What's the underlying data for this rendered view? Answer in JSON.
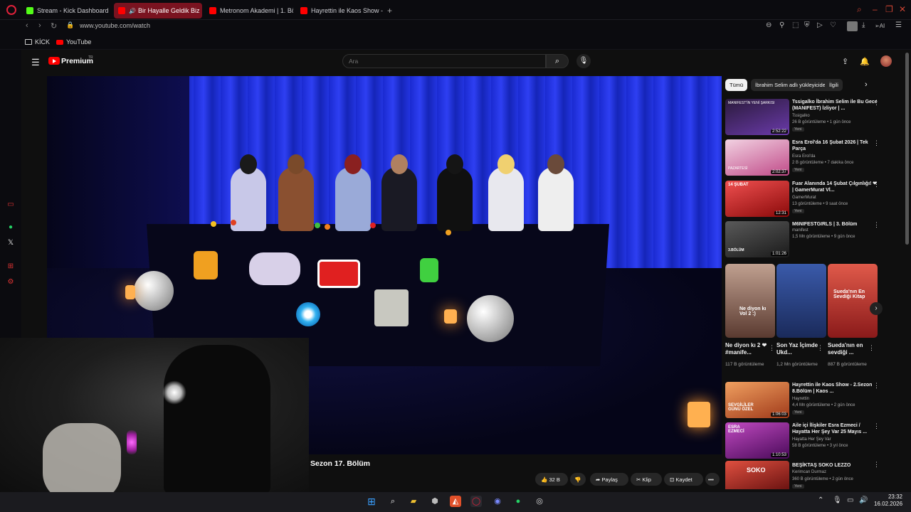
{
  "browser": {
    "tabs": [
      {
        "label": "Stream - Kick Dashboard",
        "icon": "kick-icon",
        "color": "#53fc18"
      },
      {
        "label": "Bir Hayalle Geldik Biz",
        "icon": "youtube-icon",
        "color": "#ff0000",
        "active": true
      },
      {
        "label": "Metronom Akademi | 1. Bö",
        "icon": "youtube-icon",
        "color": "#ff0000"
      },
      {
        "label": "Hayrettin ile Kaos Show - 2",
        "icon": "youtube-icon",
        "color": "#ff0000"
      }
    ],
    "url": "www.youtube.com/watch",
    "ai_label": "AI",
    "bookmarks": [
      {
        "label": "KİCK",
        "icon": "folder-icon"
      },
      {
        "label": "YouTube",
        "icon": "youtube-icon"
      }
    ]
  },
  "youtube": {
    "brand": "Premium",
    "region": "TR",
    "search_placeholder": "Ara"
  },
  "video": {
    "title": "Sezon 17. Bölüm",
    "like_count": "32 B",
    "share_label": "Paylaş",
    "clip_label": "Klip",
    "save_label": "Kaydet",
    "more_label": "•••"
  },
  "chips": [
    "Tümü",
    "İbrahim Selim adlı yükleyiciden",
    "İlgili"
  ],
  "recommendations": [
    {
      "title": "Tssigalko İbrahim Selim ile Bu Gece (MANIFEST) İzliyor | ...",
      "channel": "Tssigalko",
      "meta": "26 B görüntüleme • 1 gün önce",
      "badge": "Yeni",
      "duration": "2:52:22",
      "thumb_color": "#5a3a7a",
      "thumb_text": "MANIFEST'İN YENİ ŞARKISI"
    },
    {
      "title": "Esra Erol'da 16 Şubat 2026 | Tek Parça",
      "channel": "Esra Erol'da",
      "meta": "2 B görüntüleme • 7 dakika önce",
      "badge": "Yeni",
      "duration": "2:02:37",
      "thumb_color": "#e07aa8",
      "thumb_text": "PAZARTESİ"
    },
    {
      "title": "Fuar Alanında 14 Şubat Çılgınlığı! ❤ | GamerMurat Vl...",
      "channel": "GamerMurat",
      "meta": "13 görüntüleme • 9 saat önce",
      "badge": "Yeni",
      "duration": "12:31",
      "thumb_color": "#c01818",
      "thumb_text": "14 ŞUBAT"
    },
    {
      "title": "M6NIFESTGIRLS | 3. Bölüm",
      "channel": "manifest",
      "meta": "1,5 Mn görüntüleme • 9 gün önce",
      "badge": "",
      "duration": "1:01:26",
      "thumb_color": "#3a3a3a",
      "thumb_text": "3.BÖLÜM"
    }
  ],
  "shorts": [
    {
      "title": "Ne diyon kı 2 ❤#manife...",
      "views": "117 B görüntüleme",
      "thumb_color": "#8a6a5a",
      "thumb_text": "Ne diyon kı Vol 2 :)"
    },
    {
      "title": "Son Yaz İçimde Ukd...",
      "views": "1,2 Mn görüntüleme",
      "thumb_color": "#2a4a8a",
      "thumb_text": ""
    },
    {
      "title": "Sueda'nın en sevdiği ...",
      "views": "887 B görüntüleme",
      "thumb_color": "#c0302a",
      "thumb_text": "Sueda'nın En Sevdiği Kitap"
    }
  ],
  "recommendations2": [
    {
      "title": "Hayrettin ile Kaos Show - 2.Sezon 8.Bölüm | Kaos ...",
      "channel": "Hayrettin",
      "meta": "4,4 Mn görüntüleme • 2 gün önce",
      "badge": "Yeni",
      "duration": "1:06:03",
      "thumb_color": "#c0602a",
      "thumb_text": "SEVGİLİLER GÜNÜ ÖZEL"
    },
    {
      "title": "Aile içi İlişkiler Esra Ezmeci / Hayatta Her Şey Var 25 Mayıs ...",
      "channel": "Hayatta Her Şey Var",
      "meta": "58 B görüntüleme • 3 yıl önce",
      "badge": "",
      "duration": "1:10:53",
      "thumb_color": "#8a2a8a",
      "thumb_text": "ESRA EZMECİ"
    },
    {
      "title": "BEŞİKTAŞ SOKO LEZZO",
      "channel": "Kerimcan Durmaz",
      "meta": "360 B görüntüleme • 2 gün önce",
      "badge": "Yeni",
      "duration": "",
      "thumb_color": "#a0302a",
      "thumb_text": "SOKO"
    }
  ],
  "clock": {
    "time": "23:32",
    "date": "16.02.2026"
  }
}
